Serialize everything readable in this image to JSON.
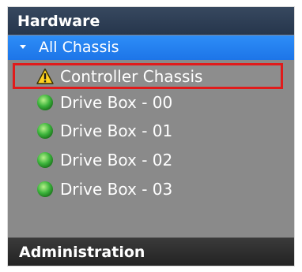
{
  "sections": {
    "hardware": {
      "label": "Hardware"
    },
    "administration": {
      "label": "Administration"
    }
  },
  "tree": {
    "root": {
      "label": "All Chassis",
      "expanded": true
    },
    "items": [
      {
        "label": "Controller Chassis",
        "status": "warning",
        "icon": "warning-icon",
        "selected": true
      },
      {
        "label": "Drive Box - 00",
        "status": "normal",
        "icon": "status-ok-icon"
      },
      {
        "label": "Drive Box - 01",
        "status": "normal",
        "icon": "status-ok-icon"
      },
      {
        "label": "Drive Box - 02",
        "status": "normal",
        "icon": "status-ok-icon"
      },
      {
        "label": "Drive Box - 03",
        "status": "normal",
        "icon": "status-ok-icon"
      }
    ]
  },
  "colors": {
    "panel_bg": "#8a8a8a",
    "selection_outline": "#e01b1b",
    "root_highlight": "#1d75e8",
    "warning": "#ffd21f",
    "ok": "#2fa52f"
  }
}
